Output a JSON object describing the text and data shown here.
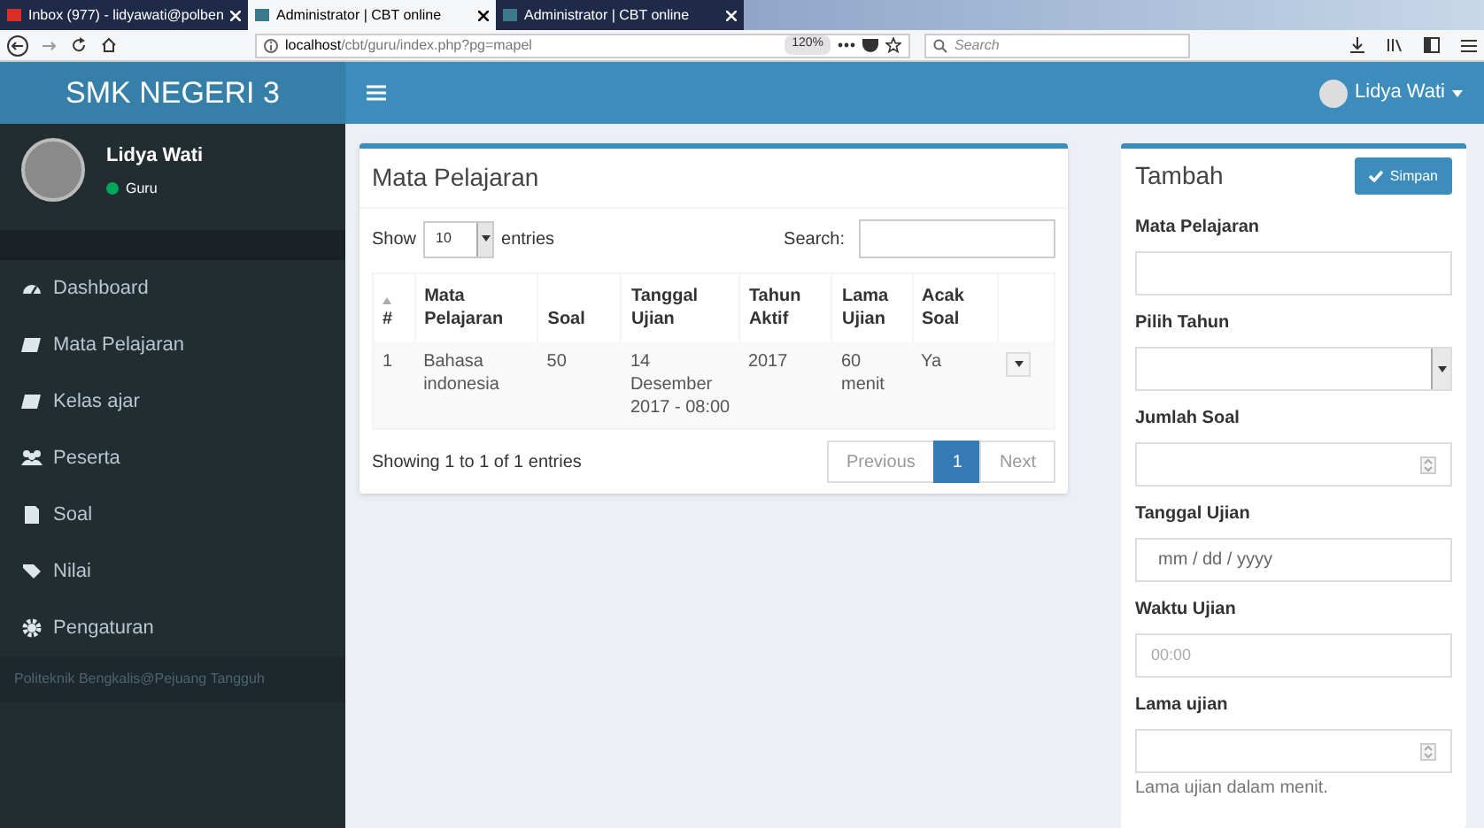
{
  "browser": {
    "tabs": [
      {
        "label": "Inbox (977) - lidyawati@polben",
        "selected": false,
        "kind": "mail"
      },
      {
        "label": "Administrator | CBT online",
        "selected": true,
        "kind": "site"
      },
      {
        "label": "Administrator | CBT online",
        "selected": false,
        "kind": "site"
      }
    ],
    "url": {
      "host": "localhost",
      "path": "/cbt/guru/index.php?pg=mapel"
    },
    "zoom": "120%",
    "search_placeholder": "Search"
  },
  "header": {
    "brand": "SMK NEGERI 3",
    "user": "Lidya Wati"
  },
  "sidebar": {
    "user": {
      "name": "Lidya Wati",
      "role": "Guru",
      "online": true
    },
    "items": [
      {
        "label": "Dashboard"
      },
      {
        "label": "Mata Pelajaran"
      },
      {
        "label": "Kelas ajar"
      },
      {
        "label": "Peserta"
      },
      {
        "label": "Soal"
      },
      {
        "label": "Nilai"
      },
      {
        "label": "Pengaturan"
      }
    ],
    "footer": "Politeknik Bengkalis@Pejuang Tangguh"
  },
  "table_panel": {
    "title": "Mata Pelajaran",
    "show_label": "Show",
    "page_size": "10",
    "entries_label": "entries",
    "search_label": "Search:",
    "columns": [
      "#",
      "Mata Pelajaran",
      "Soal",
      "Tanggal Ujian",
      "Tahun Aktif",
      "Lama Ujian",
      "Acak Soal"
    ],
    "rows": [
      [
        "1",
        "Bahasa indonesia",
        "50",
        "14 Desember 2017 - 08:00",
        "2017",
        "60 menit",
        "Ya"
      ]
    ],
    "info": "Showing 1 to 1 of 1 entries",
    "pagination": [
      {
        "label": "Previous",
        "selected": false
      },
      {
        "label": "1",
        "selected": true
      },
      {
        "label": "Next",
        "selected": false
      }
    ]
  },
  "form_panel": {
    "title": "Tambah",
    "save_button": "Simpan",
    "fields": [
      {
        "label": "Mata Pelajaran",
        "kind": "text"
      },
      {
        "label": "Pilih Tahun",
        "kind": "select"
      },
      {
        "label": "Jumlah Soal",
        "kind": "number"
      },
      {
        "label": "Tanggal Ujian",
        "kind": "date",
        "placeholder": "mm / dd / yyyy"
      },
      {
        "label": "Waktu Ujian",
        "kind": "time",
        "placeholder": "00:00"
      },
      {
        "label": "Lama ujian",
        "kind": "number",
        "help": "Lama ujian dalam menit."
      }
    ]
  }
}
